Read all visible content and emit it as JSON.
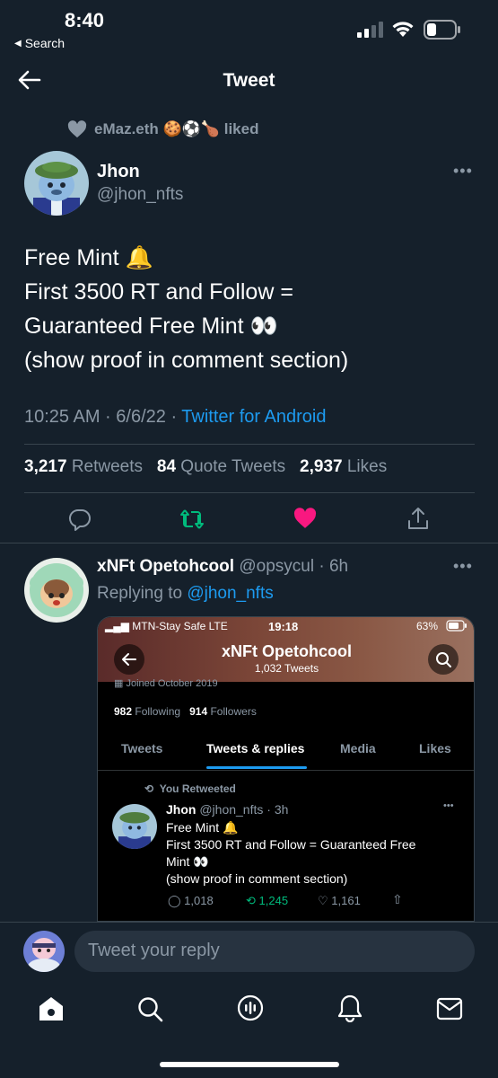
{
  "status_bar": {
    "time": "8:40",
    "back_app": "Search",
    "battery_level": 0.35
  },
  "header": {
    "title": "Tweet"
  },
  "tweet": {
    "liked_by": "eMaz.eth 🍪⚽🍗 liked",
    "author_name": "Jhon",
    "author_handle": "@jhon_nfts",
    "body": "Free Mint 🔔\nFirst 3500 RT and Follow  =\nGuaranteed Free Mint 👀\n(show proof in comment section)",
    "time": "10:25 AM · 6/6/22 · ",
    "source": "Twitter for Android",
    "retweets_count": "3,217",
    "retweets_label": "Retweets",
    "quotes_count": "84",
    "quotes_label": "Quote Tweets",
    "likes_count": "2,937",
    "likes_label": "Likes",
    "liked": true
  },
  "reply": {
    "author_name": "xNFt Opetohcool",
    "author_meta": "@opsycul · 6h",
    "replying_to_label": "Replying to ",
    "replying_to_handle": "@jhon_nfts",
    "screenshot": {
      "carrier": "MTN-Stay Safe  LTE",
      "time": "19:18",
      "battery": "63%",
      "profile_name": "xNFt Opetohcool",
      "tweet_count": "1,032 Tweets",
      "joined": "Joined October 2019",
      "following_count": "982",
      "following_label": "Following",
      "followers_count": "914",
      "followers_label": "Followers",
      "tabs": [
        "Tweets",
        "Tweets & replies",
        "Media",
        "Likes"
      ],
      "active_tab": "Tweets & replies",
      "retweeted_label": "You Retweeted",
      "tweet_author": "Jhon",
      "tweet_meta": "@jhon_nfts · 3h",
      "tweet_line1": "Free Mint 🔔",
      "tweet_line2": "First 3500 RT and Follow  = Guaranteed Free",
      "tweet_line3": "Mint 👀",
      "tweet_line4": "(show proof in comment section)",
      "replies": "1,018",
      "retweets": "1,245",
      "likes": "1,161"
    }
  },
  "reply_bar": {
    "placeholder": "Tweet your reply"
  },
  "nav": {
    "items": [
      "home-icon",
      "search-icon",
      "spaces-icon",
      "notifications-icon",
      "messages-icon"
    ]
  },
  "colors": {
    "background": "#15202b",
    "accent": "#1d9bf0",
    "retweet": "#00ba7c",
    "like": "#f91880",
    "muted": "#8b98a5"
  }
}
